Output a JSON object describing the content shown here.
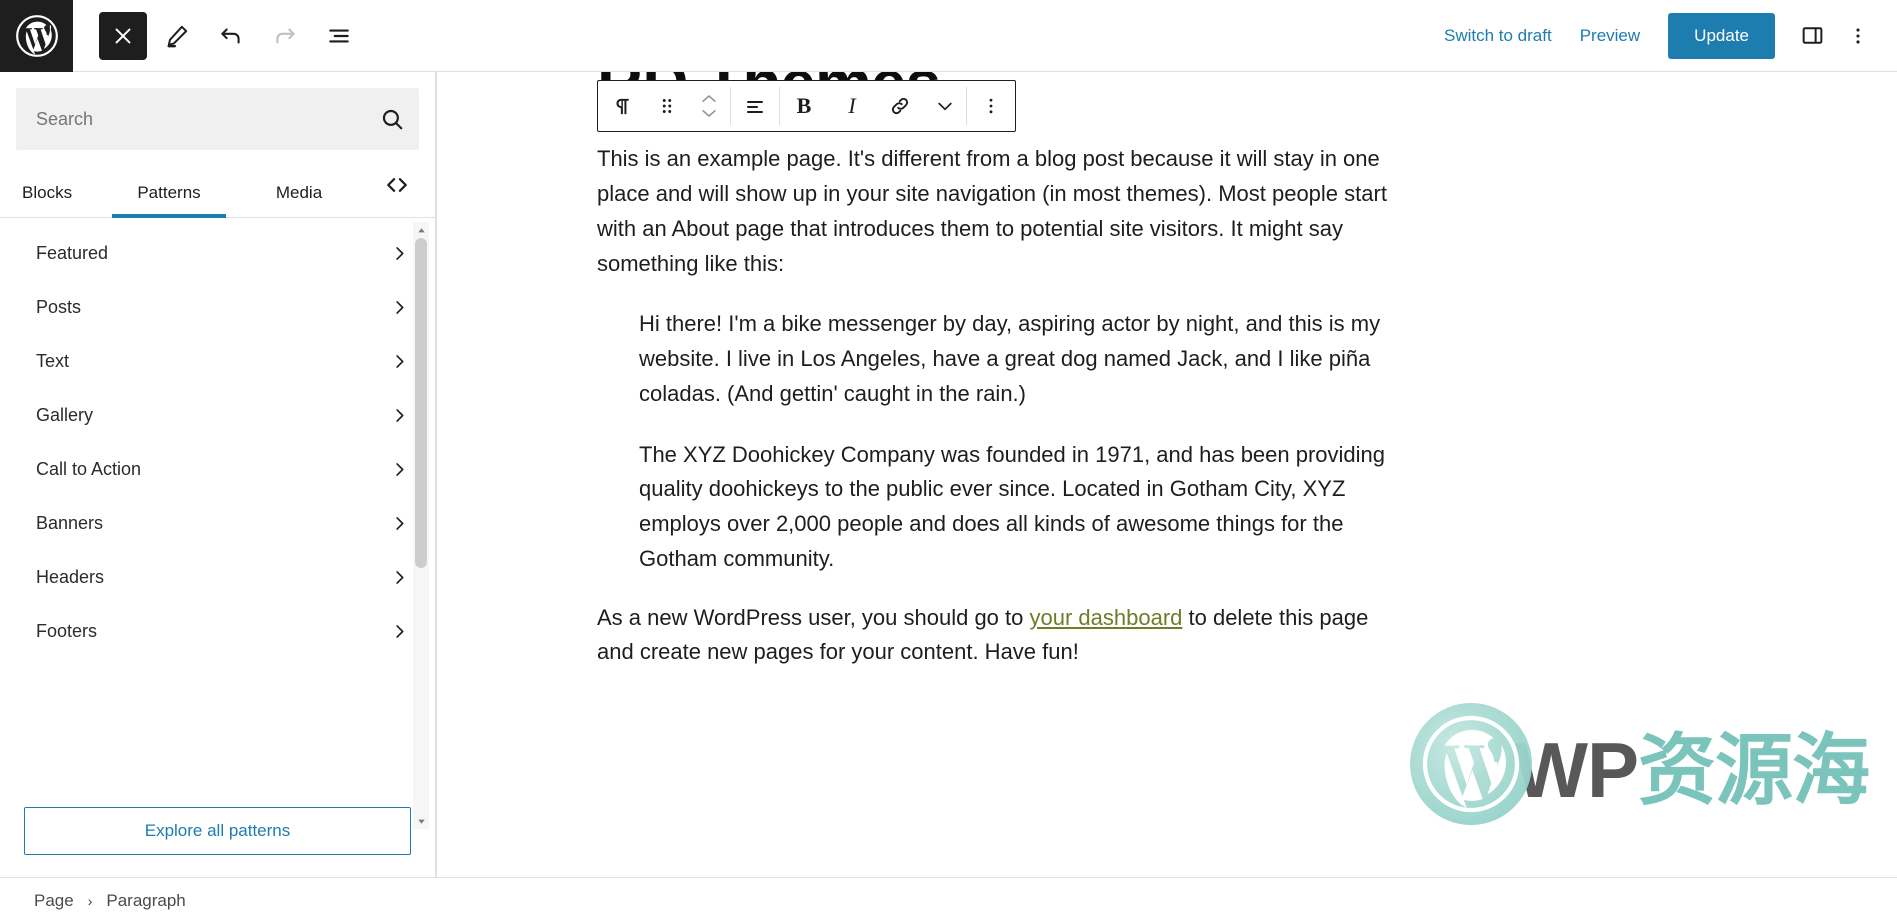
{
  "header": {
    "logo_icon": "wordpress-logo",
    "close_icon": "close-icon",
    "edit_icon": "pencil-icon",
    "undo_icon": "undo-icon",
    "redo_icon": "redo-icon",
    "listview_icon": "list-view-icon",
    "switch_to_draft_label": "Switch to draft",
    "preview_label": "Preview",
    "update_label": "Update",
    "sidebar_toggle_icon": "sidebar-panel-icon",
    "options_icon": "three-dots-vertical-icon",
    "accent_color": "#1d7dae",
    "logo_bg": "#1e1e1e"
  },
  "sidebar": {
    "search": {
      "placeholder": "Search",
      "value": "",
      "icon": "search-icon"
    },
    "tabs": [
      {
        "label": "Blocks",
        "active": false
      },
      {
        "label": "Patterns",
        "active": true
      },
      {
        "label": "Media",
        "active": false
      }
    ],
    "code_icon": "code-brackets-icon",
    "categories": [
      {
        "label": "Featured"
      },
      {
        "label": "Posts"
      },
      {
        "label": "Text"
      },
      {
        "label": "Gallery"
      },
      {
        "label": "Call to Action"
      },
      {
        "label": "Banners"
      },
      {
        "label": "Headers"
      },
      {
        "label": "Footers"
      }
    ],
    "explore_label": "Explore all patterns"
  },
  "block_toolbar": {
    "block_type_icon": "paragraph-icon",
    "drag_icon": "drag-handle-icon",
    "move_up_icon": "chevron-up-icon",
    "move_down_icon": "chevron-down-icon",
    "align_icon": "align-text-icon",
    "bold_label": "B",
    "italic_label": "I",
    "link_icon": "link-icon",
    "more_rich_text_icon": "chevron-down-icon",
    "options_icon": "three-dots-vertical-icon"
  },
  "content": {
    "title": "RD Themes",
    "paragraph_1": "This is an example page. It's different from a blog post because it will stay in one place and will show up in your site navigation (in most themes). Most people start with an About page that introduces them to potential site visitors. It might say something like this:",
    "quote_1": "Hi there! I'm a bike messenger by day, aspiring actor by night, and this is my website. I live in Los Angeles, have a great dog named Jack, and I like piña coladas. (And gettin' caught in the rain.)",
    "quote_2": "The XYZ Doohickey Company was founded in 1971, and has been providing quality doohickeys to the public ever since. Located in Gotham City, XYZ employs over 2,000 people and does all kinds of awesome things for the Gotham community.",
    "paragraph_2_before": "As a new WordPress user, you should go to ",
    "paragraph_2_link": "your dashboard",
    "paragraph_2_after": " to delete this page and create new pages for your content. Have fun!",
    "link_color": "#6f7c28"
  },
  "footer": {
    "breadcrumb": [
      {
        "label": "Page"
      },
      {
        "label": "Paragraph"
      }
    ],
    "separator": "›"
  },
  "watermark": {
    "text_latin": "WP",
    "text_cn": "资源海",
    "icon": "wordpress-logo"
  }
}
